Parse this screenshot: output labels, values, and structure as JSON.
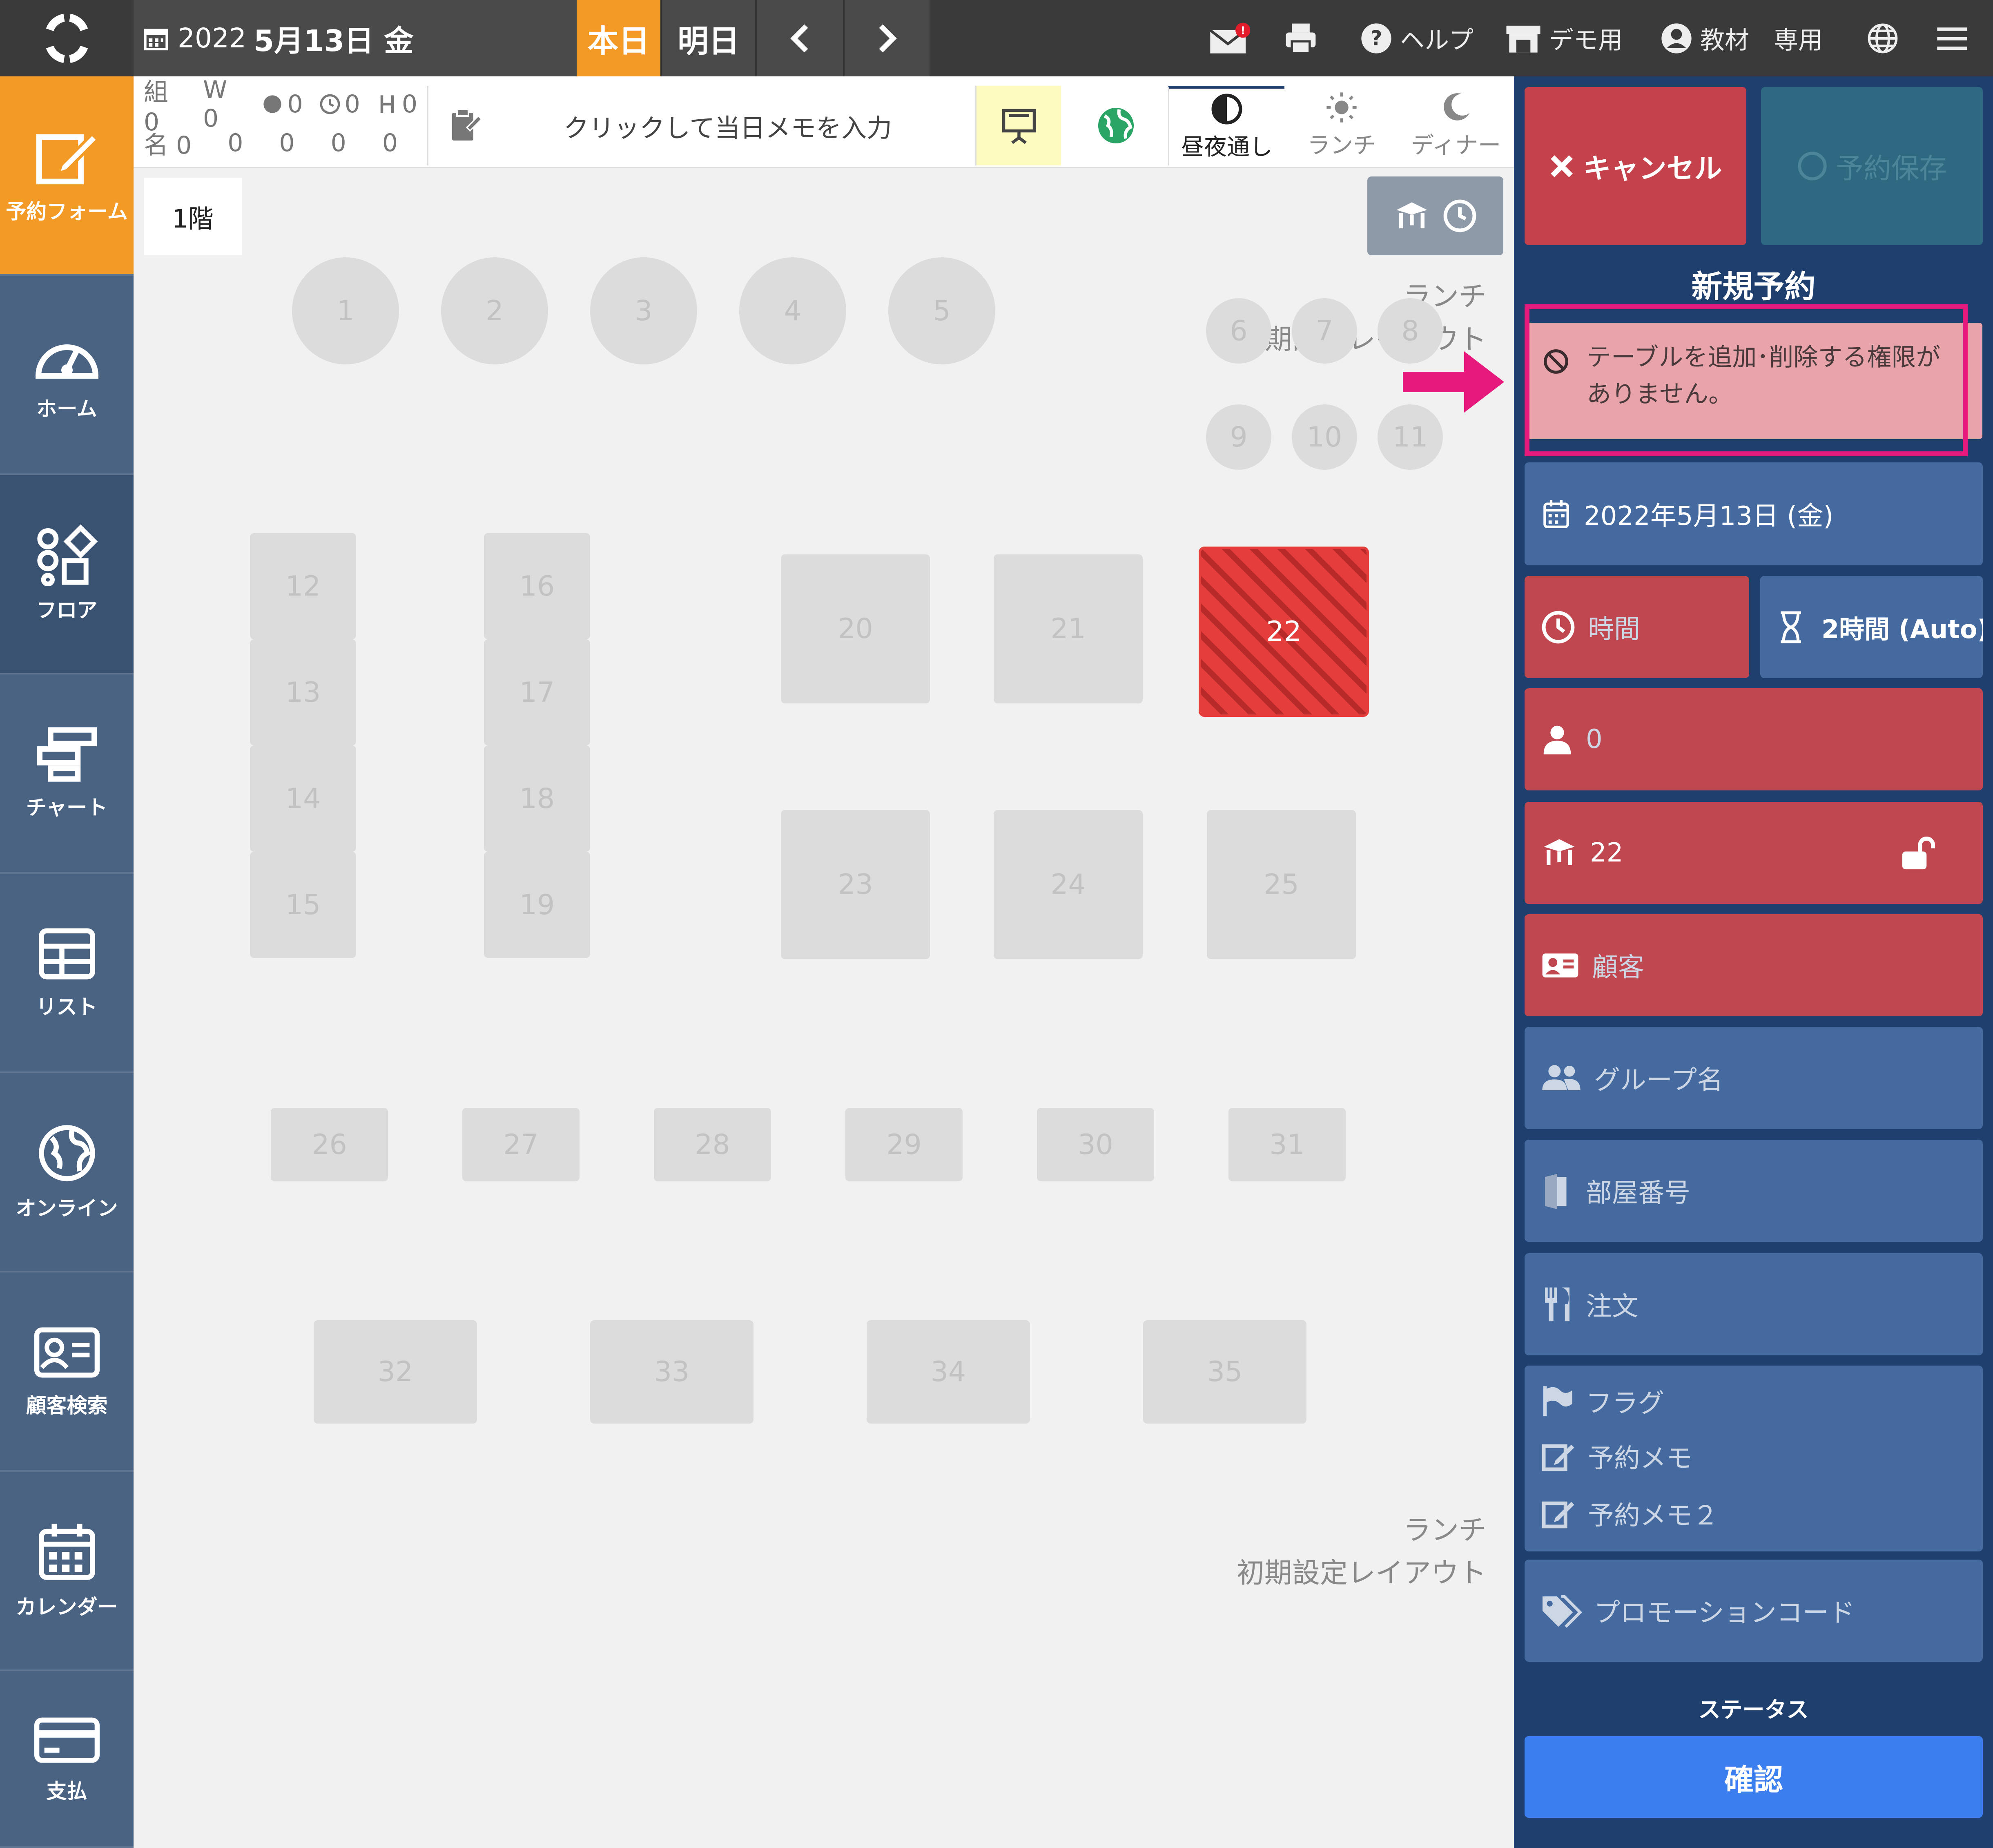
{
  "header": {
    "year": "2022",
    "date": "5月13日 金",
    "today_label": "本日",
    "tomorrow_label": "明日",
    "notification_badge": "!",
    "help_label": "ヘルプ",
    "demo_label": "デモ用",
    "user_label": "教材　専用",
    "accent_color": "#f39a26"
  },
  "sidebar": {
    "items": [
      {
        "label": "予約フォーム",
        "icon": "edit-icon"
      },
      {
        "label": "ホーム",
        "icon": "dashboard-icon"
      },
      {
        "label": "フロア",
        "icon": "shapes-icon"
      },
      {
        "label": "チャート",
        "icon": "chart-icon"
      },
      {
        "label": "リスト",
        "icon": "table-icon"
      },
      {
        "label": "オンライン",
        "icon": "globe-icon"
      },
      {
        "label": "顧客検索",
        "icon": "id-card-icon"
      },
      {
        "label": "カレンダー",
        "icon": "calendar-icon"
      },
      {
        "label": "支払",
        "icon": "credit-card-icon"
      }
    ]
  },
  "stats": {
    "row1": [
      "組 0",
      "W 0",
      "0",
      "0",
      "0"
    ],
    "row2": [
      "名 0",
      "0",
      "0",
      "0",
      "0"
    ]
  },
  "memo": {
    "placeholder": "クリックして当日メモを入力"
  },
  "mode_tabs": {
    "all_day": "昼夜通し",
    "lunch": "ランチ",
    "dinner": "ディナー"
  },
  "floor": {
    "tab": "1階",
    "layout_label_top": "ランチ",
    "layout_name_top": "初期設定レイアウト",
    "layout_label_bottom": "ランチ",
    "layout_name_bottom": "初期設定レイアウト",
    "tables": [
      "1",
      "2",
      "3",
      "4",
      "5",
      "6",
      "7",
      "8",
      "9",
      "10",
      "11",
      "12",
      "13",
      "14",
      "15",
      "16",
      "17",
      "18",
      "19",
      "20",
      "21",
      "22",
      "23",
      "24",
      "25",
      "26",
      "27",
      "28",
      "29",
      "30",
      "31",
      "32",
      "33",
      "34",
      "35"
    ],
    "selected_table": "22"
  },
  "form": {
    "cancel_label": "キャンセル",
    "save_label": "予約保存",
    "title": "新規予約",
    "error_message": "テーブルを追加･削除する権限がありません。",
    "date_value": "2022年5月13日 (金)",
    "time_label": "時間",
    "duration_value": "2時間 (Auto)",
    "guests_value": "0",
    "table_value": "22",
    "customer_label": "顧客",
    "group_label": "グループ名",
    "room_label": "部屋番号",
    "order_label": "注文",
    "flag_label": "フラグ",
    "memo1_label": "予約メモ",
    "memo2_label": "予約メモ２",
    "promo_label": "プロモーションコード",
    "status_heading": "ステータス",
    "status_value": "確認"
  }
}
